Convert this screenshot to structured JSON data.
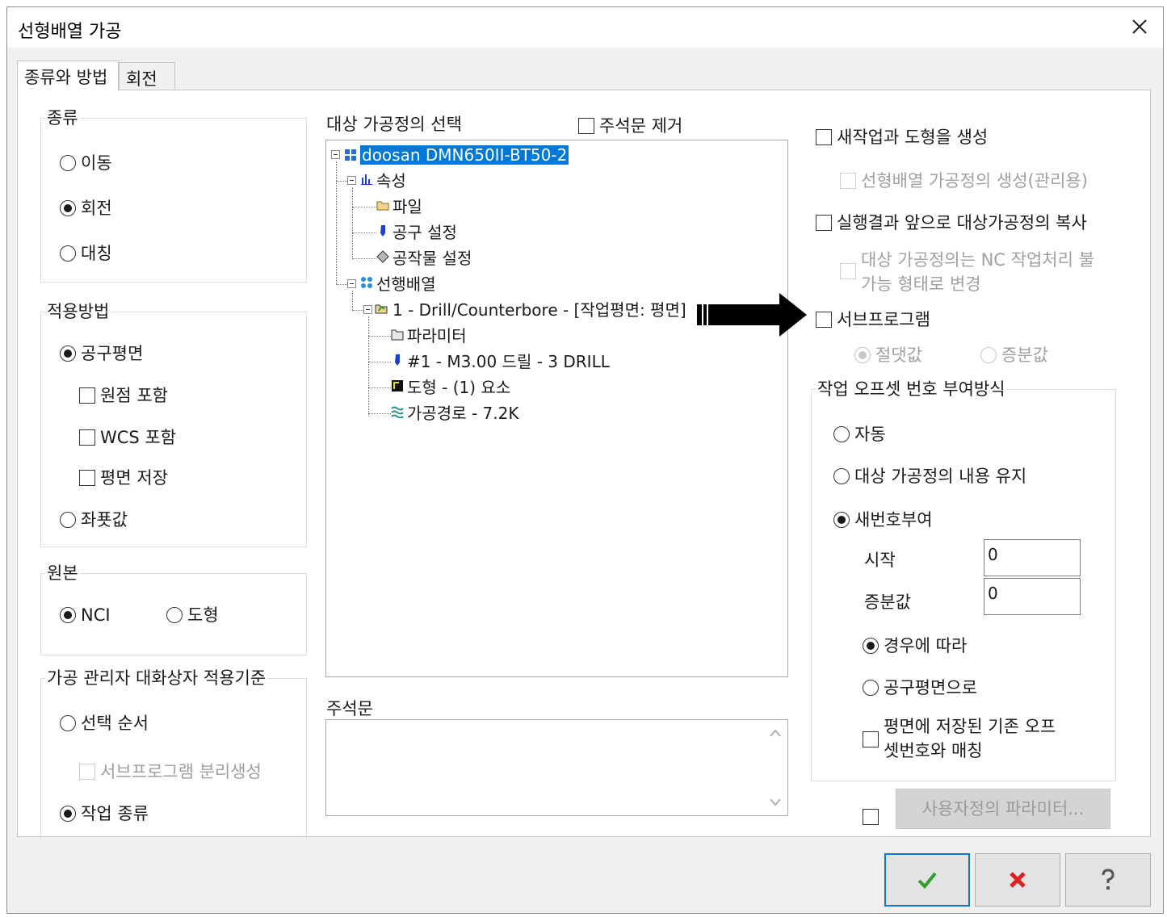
{
  "window": {
    "title": "선형배열 가공"
  },
  "tabs": [
    {
      "label": "종류와 방법"
    },
    {
      "label": "회전"
    }
  ],
  "type_group": {
    "legend": "종류",
    "options": [
      {
        "label": "이동"
      },
      {
        "label": "회전"
      },
      {
        "label": "대칭"
      }
    ],
    "selected": "회전"
  },
  "method_group": {
    "legend": "적용방법",
    "tool_plane": "공구평면",
    "include_origin": "원점 포함",
    "include_wcs": "WCS 포함",
    "save_plane": "평면 저장",
    "coordinates": "좌푯값"
  },
  "source_group": {
    "legend": "원본",
    "nci": "NCI",
    "geometry": "도형"
  },
  "manager_group": {
    "legend": "가공 관리자 대화상자 적용기준",
    "selection_order": "선택 순서",
    "subprogram_separate": "서브프로그램 분리생성",
    "operation_type": "작업 종류"
  },
  "target": {
    "label": "대상 가공정의 선택",
    "remove_comments": "주석문 제거",
    "tree": {
      "root": "doosan DMN650II-BT50-2",
      "properties": "속성",
      "file": "파일",
      "tool_settings": "공구 설정",
      "stock_settings": "공작물 설정",
      "linear_array": "선행배열",
      "operation": "1 - Drill/Counterbore - [작업평면: 평면]",
      "parameters": "파라미터",
      "tool": "#1 - M3.00 드릴 - 3 DRILL",
      "geometry": "도형 - (1) 요소",
      "toolpath": "가공경로 - 7.2K"
    }
  },
  "comment": {
    "label": "주석문",
    "value": ""
  },
  "right": {
    "new_op_geom": "새작업과 도형을 생성",
    "create_array_op": "선형배열 가공정의 생성(관리용)",
    "copy_before": "실행결과 앞으로 대상가공정의 복사",
    "convert_nc_line1": "대상 가공정의는 NC 작업처리 불",
    "convert_nc_line2": "가능 형태로 변경",
    "subprogram": "서브프로그램",
    "absolute": "절댓값",
    "incremental": "증분값"
  },
  "offset_group": {
    "legend": "작업 오프셋 번호 부여방식",
    "auto": "자동",
    "keep": "대상 가공정의 내용 유지",
    "renumber": "새번호부여",
    "start_label": "시작",
    "start_value": "0",
    "increment_label": "증분값",
    "increment_value": "0",
    "per_case": "경우에 따라",
    "per_tool_plane": "공구평면으로",
    "match_line1": "평면에 저장된 기존 오프",
    "match_line2": "셋번호와 매칭"
  },
  "custom_params": {
    "label": "사용자정의 파라미터..."
  },
  "buttons": {
    "ok": "ok-icon",
    "cancel": "cancel-icon",
    "help": "help-icon"
  },
  "colors": {
    "selection": "#0078d7",
    "ok": "#2e9e2e",
    "cancel": "#e02020",
    "arrow": "#000000"
  }
}
